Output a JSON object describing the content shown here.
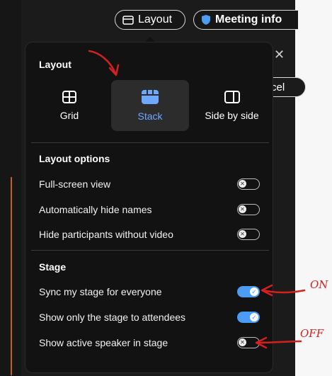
{
  "toolbar": {
    "layout_label": "Layout",
    "meeting_info_label": "Meeting info"
  },
  "background": {
    "cancel_fragment": "cel"
  },
  "panel": {
    "title": "Layout",
    "layouts": [
      {
        "label": "Grid",
        "icon": "grid-icon",
        "selected": false
      },
      {
        "label": "Stack",
        "icon": "stack-icon",
        "selected": true
      },
      {
        "label": "Side by side",
        "icon": "side-by-side-icon",
        "selected": false
      }
    ],
    "layout_options_title": "Layout options",
    "layout_options": [
      {
        "label": "Full-screen view",
        "on": false
      },
      {
        "label": "Automatically hide names",
        "on": false
      },
      {
        "label": "Hide participants without video",
        "on": false
      }
    ],
    "stage_title": "Stage",
    "stage_options": [
      {
        "label": "Sync my stage for everyone",
        "on": true
      },
      {
        "label": "Show only the stage to attendees",
        "on": true
      },
      {
        "label": "Show active speaker in stage",
        "on": false
      }
    ]
  },
  "annotations": {
    "on_label": "ON",
    "off_label": "OFF"
  },
  "colors": {
    "accent": "#4a9cf5",
    "selected_text": "#6ea8ff",
    "annotation_red": "#d42020"
  }
}
